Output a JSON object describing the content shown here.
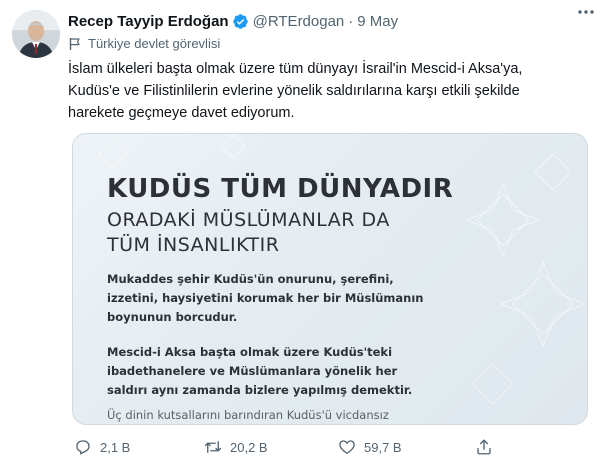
{
  "tweet": {
    "author_name": "Recep Tayyip Erdoğan",
    "handle": "@RTErdogan",
    "separator": "·",
    "date": "9 May",
    "account_label": "Türkiye devlet görevlisi",
    "text": "İslam ülkeleri başta olmak üzere tüm dünyayı İsrail'in Mescid-i Aksa'ya,\nKudüs'e ve Filistinlilerin evlerine yönelik saldırılarına karşı etkili şekilde\nharekete geçmeye davet ediyorum.",
    "media": {
      "title": "KUDÜS TÜM DÜNYADIR",
      "subtitle_line1": "ORADAKİ MÜSLÜMANLAR DA",
      "subtitle_line2": "TÜM İNSANLIKTIR",
      "paragraph1": "Mukaddes şehir Kudüs'ün onurunu, şerefini,\nizzetini, haysiyetini korumak her bir Müslümanın\nboynunun borcudur.",
      "paragraph2": "Mescid-i Aksa başta olmak üzere Kudüs'teki\nibadethanelere ve Müslümanlara yönelik her\nsaldırı aynı zamanda bizlere yapılmış demektir.",
      "paragraph3": "Üç dinin kutsallarını barındıran Kudüs'ü vicdansız"
    },
    "actions": {
      "replies": "2,1 B",
      "retweets": "20,2 B",
      "likes": "59,7 B"
    }
  },
  "icons": {
    "verified": "verified-badge-icon",
    "more": "more-icon",
    "label": "flag-icon",
    "reply": "reply-icon",
    "retweet": "retweet-icon",
    "like": "heart-icon",
    "share": "share-icon"
  },
  "colors": {
    "verified_blue": "#1d9bf0",
    "text_primary": "#0f1419",
    "text_secondary": "#536471",
    "media_text": "#2d3137"
  }
}
